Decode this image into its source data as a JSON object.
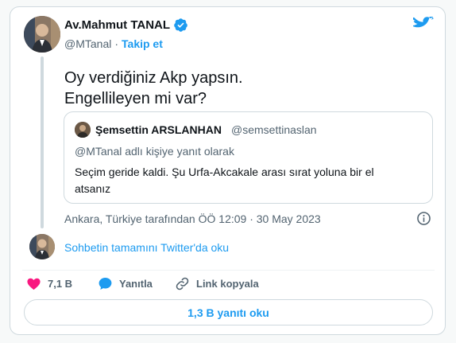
{
  "tweet": {
    "author_name": "Av.Mahmut TANAL",
    "author_handle": "@MTanal",
    "separator": "·",
    "follow_label": "Takip et",
    "text_line1": "Oy verdiğiniz Akp yapsın.",
    "text_line2": "Engellileyen mi var?",
    "location_time": "Ankara, Türkiye tarafından ÖÖ 12:09 · 30 May 2023"
  },
  "quote": {
    "author_name": "Şemsettin ARSLANHAN",
    "author_handle": "@semsettinaslan",
    "reply_context": "@MTanal adlı kişiye yanıt olarak",
    "text": "Seçim geride kaldi. Şu Urfa-Akcakale arası sırat yoluna bir el atsanız"
  },
  "thread": {
    "read_full_label": "Sohbetin tamamını Twitter'da oku"
  },
  "actions": {
    "likes": "7,1 B",
    "reply_label": "Yanıtla",
    "copy_link_label": "Link kopyala"
  },
  "replies_button_label": "1,3 B yanıtı oku",
  "icons": {
    "verified": "verified-badge-icon",
    "logo": "twitter-bird-icon",
    "info": "info-icon",
    "like": "heart-icon",
    "reply": "speech-bubble-icon",
    "link": "link-icon"
  },
  "colors": {
    "accent": "#1d9bf0",
    "like": "#f91880",
    "text": "#0f1419",
    "secondary": "#536471",
    "border": "#cfd9de"
  }
}
